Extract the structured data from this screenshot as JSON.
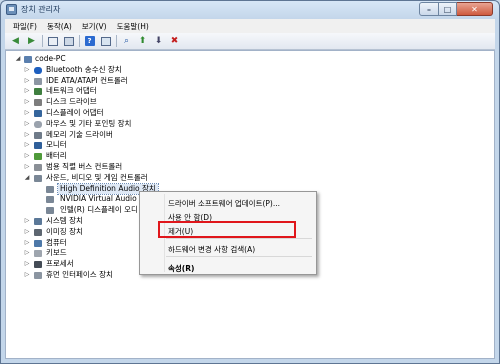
{
  "window": {
    "title": "장치 관리자"
  },
  "caption": {
    "minimize": "–",
    "maximize": "□",
    "close": "✕"
  },
  "menu": [
    "파일(F)",
    "동작(A)",
    "보기(V)",
    "도움말(H)"
  ],
  "toolbar_icons": [
    "back-arrow-icon",
    "forward-arrow-icon",
    "properties-icon",
    "view-icon",
    "help-icon",
    "view-icon-2",
    "scan-hardware-icon",
    "update-driver-icon",
    "disable-icon",
    "uninstall-icon"
  ],
  "tree": {
    "root": "code-PC",
    "categories": [
      "Bluetooth 송수신 장치",
      "IDE ATA/ATAPI 컨트롤러",
      "네트워크 어댑터",
      "디스크 드라이브",
      "디스플레이 어댑터",
      "마우스 및 기타 포인팅 장치",
      "메모리 기술 드라이버",
      "모니터",
      "배터리",
      "범용 직렬 버스 컨트롤러",
      "사운드, 비디오 및 게임 컨트롤러"
    ],
    "sound_children": [
      "High Definition Audio 장치",
      "NVIDIA Virtual Audio D",
      "인텔(R) 디스플레이 오디"
    ],
    "more_categories": [
      "시스템 장치",
      "이미징 장치",
      "컴퓨터",
      "키보드",
      "프로세서",
      "휴먼 인터페이스 장치"
    ]
  },
  "context_menu": {
    "update": "드라이버 소프트웨어 업데이트(P)...",
    "disable": "사용 안 함(D)",
    "uninstall": "제거(U)",
    "scan": "하드웨어 변경 사항 검색(A)",
    "properties": "속성(R)"
  },
  "colors": {
    "highlight_box": "#e0161b",
    "window_frame": "#c3d6ea"
  }
}
